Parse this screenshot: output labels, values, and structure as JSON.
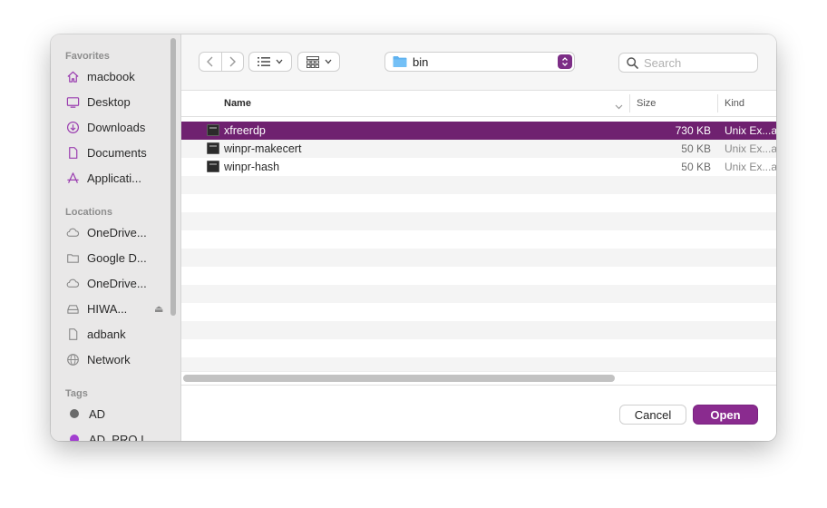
{
  "sidebar": {
    "favorites_title": "Favorites",
    "favorites": [
      {
        "label": "macbook",
        "icon": "home-icon"
      },
      {
        "label": "Desktop",
        "icon": "desktop-icon"
      },
      {
        "label": "Downloads",
        "icon": "download-icon"
      },
      {
        "label": "Documents",
        "icon": "document-icon"
      },
      {
        "label": "Applicati...",
        "icon": "applications-icon"
      }
    ],
    "locations_title": "Locations",
    "locations": [
      {
        "label": "OneDrive...",
        "icon": "cloud-icon"
      },
      {
        "label": "Google D...",
        "icon": "folder-icon"
      },
      {
        "label": "OneDrive...",
        "icon": "cloud-icon"
      },
      {
        "label": "HIWA...",
        "icon": "drive-icon"
      },
      {
        "label": "adbank",
        "icon": "file-icon"
      },
      {
        "label": "Network",
        "icon": "globe-icon"
      }
    ],
    "tags_title": "Tags",
    "tags": [
      {
        "label": "AD",
        "color": "#6b6b6b"
      },
      {
        "label": "AD_PRO I",
        "color": "#a23fd0"
      }
    ]
  },
  "toolbar": {
    "path_folder": "bin",
    "search_placeholder": "Search"
  },
  "columns": {
    "name": "Name",
    "size": "Size",
    "kind": "Kind"
  },
  "files": [
    {
      "name": "xfreerdp",
      "size": "730 KB",
      "kind": "Unix Ex...a",
      "selected": true
    },
    {
      "name": "winpr-makecert",
      "size": "50 KB",
      "kind": "Unix Ex...a",
      "selected": false
    },
    {
      "name": "winpr-hash",
      "size": "50 KB",
      "kind": "Unix Ex...a",
      "selected": false
    }
  ],
  "buttons": {
    "cancel": "Cancel",
    "open": "Open"
  },
  "colors": {
    "accent": "#8a2b8f",
    "selection": "#6f2170"
  }
}
